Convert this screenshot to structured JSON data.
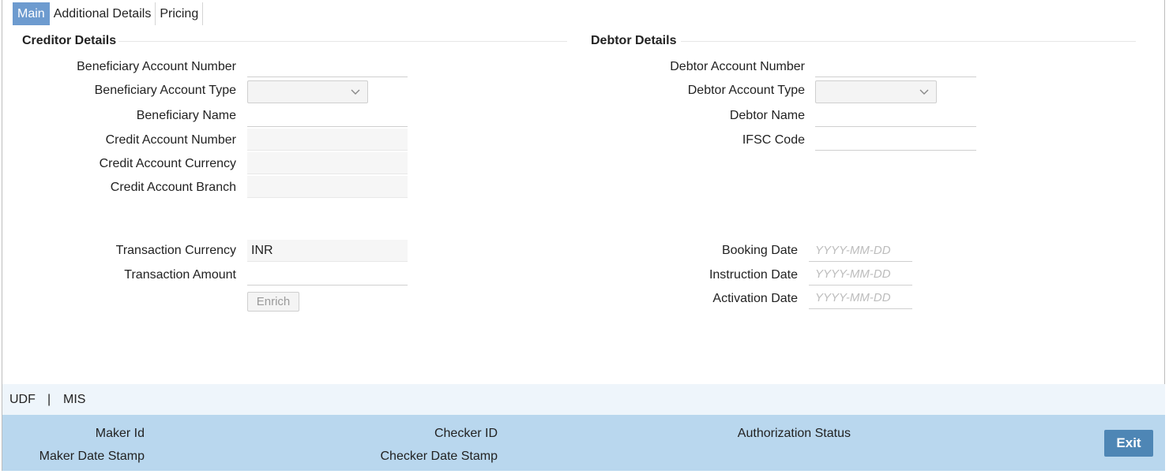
{
  "tabs": [
    {
      "label": "Main",
      "active": true
    },
    {
      "label": "Additional Details",
      "active": false
    },
    {
      "label": "Pricing",
      "active": false
    }
  ],
  "creditor": {
    "title": "Creditor Details",
    "beneficiary_account_number": {
      "label": "Beneficiary Account Number",
      "value": ""
    },
    "beneficiary_account_type": {
      "label": "Beneficiary Account Type",
      "value": ""
    },
    "beneficiary_name": {
      "label": "Beneficiary Name",
      "value": ""
    },
    "credit_account_number": {
      "label": "Credit Account Number",
      "value": ""
    },
    "credit_account_currency": {
      "label": "Credit Account Currency",
      "value": ""
    },
    "credit_account_branch": {
      "label": "Credit Account Branch",
      "value": ""
    },
    "transaction_currency": {
      "label": "Transaction Currency",
      "value": "INR"
    },
    "transaction_amount": {
      "label": "Transaction Amount",
      "value": ""
    },
    "enrich_label": "Enrich"
  },
  "debtor": {
    "title": "Debtor Details",
    "debtor_account_number": {
      "label": "Debtor Account Number",
      "value": ""
    },
    "debtor_account_type": {
      "label": "Debtor Account Type",
      "value": ""
    },
    "debtor_name": {
      "label": "Debtor Name",
      "value": ""
    },
    "ifsc_code": {
      "label": "IFSC Code",
      "value": ""
    },
    "booking_date": {
      "label": "Booking Date",
      "placeholder": "YYYY-MM-DD"
    },
    "instruction_date": {
      "label": "Instruction Date",
      "placeholder": "YYYY-MM-DD"
    },
    "activation_date": {
      "label": "Activation Date",
      "placeholder": "YYYY-MM-DD"
    }
  },
  "links": {
    "udf": "UDF",
    "separator": "|",
    "mis": "MIS"
  },
  "footer": {
    "maker_id": "Maker Id",
    "maker_date_stamp": "Maker Date Stamp",
    "checker_id": "Checker ID",
    "checker_date_stamp": "Checker Date Stamp",
    "authorization_status": "Authorization Status",
    "exit_label": "Exit"
  },
  "colors": {
    "accent": "#6d9bcf",
    "footer_bg": "#b9d7ee",
    "exit_bg": "#4e86b5"
  }
}
